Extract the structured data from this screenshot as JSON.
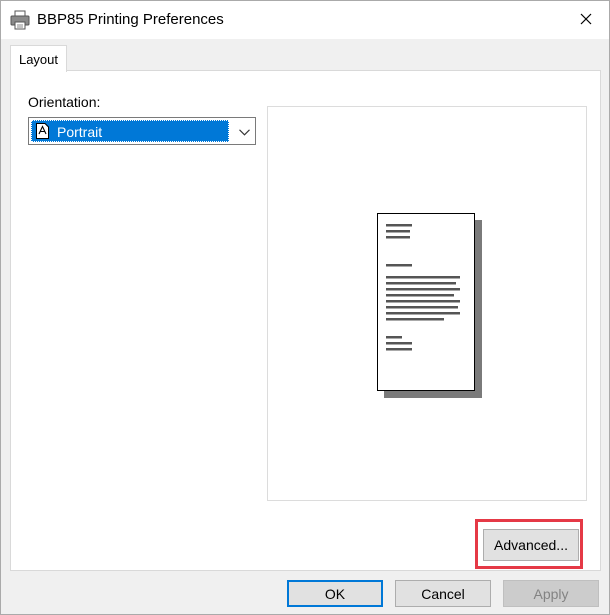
{
  "window": {
    "title": "BBP85 Printing Preferences",
    "close_glyph": "✕"
  },
  "tabs": [
    {
      "label": "Layout",
      "selected": true
    }
  ],
  "layout": {
    "orientation_label": "Orientation:",
    "orientation_value": "Portrait",
    "orientation_options_visible": [
      "Portrait"
    ],
    "advanced_label": "Advanced..."
  },
  "footer": {
    "ok_label": "OK",
    "cancel_label": "Cancel",
    "apply_label": "Apply",
    "apply_disabled": true
  },
  "colors": {
    "selection": "#0078d7",
    "highlight_border": "#e53946",
    "button_face": "#e1e1e1",
    "window_bg": "#f0f0f0"
  },
  "icons": {
    "title": "printer-icon",
    "close": "close-icon",
    "orientation": "portrait-page-icon",
    "dropdown": "chevron-down-icon"
  }
}
